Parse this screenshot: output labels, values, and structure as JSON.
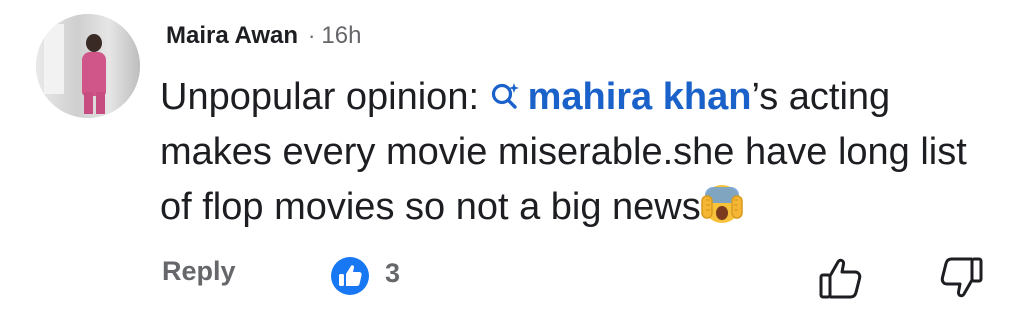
{
  "comment": {
    "author": "Maira Awan",
    "separator": "·",
    "time": "16h",
    "text_before": "Unpopular opinion: ",
    "tag": "mahira khan",
    "text_after": "’s acting makes every movie miserable.she have long list of flop movies so not a big news",
    "emoji": "fearful-face-hands-over-eyes"
  },
  "actions": {
    "reply_label": "Reply",
    "like_count": "3",
    "like_button": "thumbs-up-icon",
    "dislike_button": "thumbs-down-icon"
  },
  "colors": {
    "tag": "#1a62c9",
    "meta": "#65676b",
    "like_badge": "#1877f2"
  }
}
